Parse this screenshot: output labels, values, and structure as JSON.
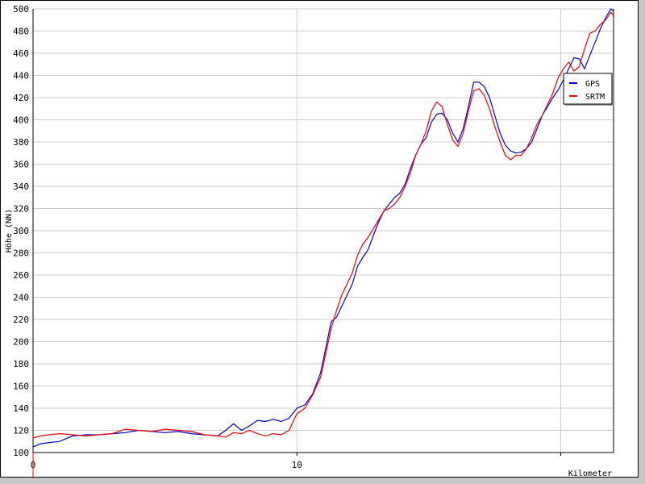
{
  "chart_data": {
    "type": "line",
    "title": "",
    "xlabel": "Kilometer",
    "ylabel": "Höhe (NN)",
    "xlim": [
      0,
      22
    ],
    "ylim": [
      100,
      500
    ],
    "xticks": [
      0,
      10,
      20
    ],
    "xtick_labels": [
      "0",
      "10",
      ""
    ],
    "yticks": [
      100,
      120,
      140,
      160,
      180,
      200,
      220,
      240,
      260,
      280,
      300,
      320,
      340,
      360,
      380,
      400,
      420,
      440,
      460,
      480,
      500
    ],
    "grid": true,
    "legend_position": "right",
    "series": [
      {
        "name": "GPS",
        "color": "#0000dd",
        "points": [
          [
            0.0,
            105
          ],
          [
            0.3,
            108
          ],
          [
            0.6,
            109
          ],
          [
            1.0,
            110
          ],
          [
            1.5,
            115
          ],
          [
            2.0,
            116
          ],
          [
            2.5,
            116
          ],
          [
            3.0,
            117
          ],
          [
            3.5,
            118
          ],
          [
            4.0,
            120
          ],
          [
            4.5,
            119
          ],
          [
            5.0,
            118
          ],
          [
            5.5,
            119
          ],
          [
            6.0,
            117
          ],
          [
            6.5,
            116
          ],
          [
            7.0,
            115
          ],
          [
            7.3,
            120
          ],
          [
            7.6,
            126
          ],
          [
            7.9,
            120
          ],
          [
            8.2,
            124
          ],
          [
            8.5,
            129
          ],
          [
            8.8,
            128
          ],
          [
            9.1,
            130
          ],
          [
            9.4,
            128
          ],
          [
            9.7,
            131
          ],
          [
            10.0,
            140
          ],
          [
            10.3,
            143
          ],
          [
            10.6,
            153
          ],
          [
            10.9,
            172
          ],
          [
            11.1,
            195
          ],
          [
            11.3,
            218
          ],
          [
            11.5,
            222
          ],
          [
            11.7,
            232
          ],
          [
            11.9,
            242
          ],
          [
            12.1,
            252
          ],
          [
            12.3,
            268
          ],
          [
            12.5,
            276
          ],
          [
            12.7,
            283
          ],
          [
            12.9,
            296
          ],
          [
            13.1,
            308
          ],
          [
            13.3,
            318
          ],
          [
            13.5,
            324
          ],
          [
            13.7,
            330
          ],
          [
            13.9,
            334
          ],
          [
            14.1,
            342
          ],
          [
            14.3,
            356
          ],
          [
            14.5,
            368
          ],
          [
            14.7,
            378
          ],
          [
            14.9,
            384
          ],
          [
            15.1,
            398
          ],
          [
            15.3,
            405
          ],
          [
            15.5,
            406
          ],
          [
            15.7,
            400
          ],
          [
            15.9,
            388
          ],
          [
            16.1,
            380
          ],
          [
            16.3,
            392
          ],
          [
            16.5,
            412
          ],
          [
            16.7,
            434
          ],
          [
            16.9,
            434
          ],
          [
            17.1,
            430
          ],
          [
            17.3,
            420
          ],
          [
            17.5,
            404
          ],
          [
            17.7,
            388
          ],
          [
            17.9,
            377
          ],
          [
            18.1,
            372
          ],
          [
            18.3,
            370
          ],
          [
            18.5,
            371
          ],
          [
            18.7,
            374
          ],
          [
            18.9,
            380
          ],
          [
            19.1,
            392
          ],
          [
            19.3,
            404
          ],
          [
            19.5,
            412
          ],
          [
            19.7,
            420
          ],
          [
            19.9,
            427
          ],
          [
            20.1,
            436
          ],
          [
            20.3,
            446
          ],
          [
            20.5,
            456
          ],
          [
            20.7,
            455
          ],
          [
            20.9,
            446
          ],
          [
            21.1,
            458
          ],
          [
            21.3,
            470
          ],
          [
            21.5,
            482
          ],
          [
            21.7,
            492
          ],
          [
            21.9,
            500
          ],
          [
            22.0,
            498
          ]
        ]
      },
      {
        "name": "SRTM",
        "color": "#ee0000",
        "points": [
          [
            0.0,
            113
          ],
          [
            0.3,
            115
          ],
          [
            0.6,
            116
          ],
          [
            1.0,
            117
          ],
          [
            1.5,
            116
          ],
          [
            2.0,
            115
          ],
          [
            2.5,
            116
          ],
          [
            3.0,
            117
          ],
          [
            3.5,
            121
          ],
          [
            4.0,
            120
          ],
          [
            4.5,
            119
          ],
          [
            5.0,
            121
          ],
          [
            5.5,
            120
          ],
          [
            6.0,
            119
          ],
          [
            6.5,
            116
          ],
          [
            7.0,
            115
          ],
          [
            7.3,
            114
          ],
          [
            7.6,
            118
          ],
          [
            7.9,
            117
          ],
          [
            8.2,
            120
          ],
          [
            8.5,
            117
          ],
          [
            8.8,
            115
          ],
          [
            9.1,
            117
          ],
          [
            9.4,
            116
          ],
          [
            9.7,
            120
          ],
          [
            10.0,
            135
          ],
          [
            10.3,
            140
          ],
          [
            10.6,
            152
          ],
          [
            10.9,
            168
          ],
          [
            11.1,
            190
          ],
          [
            11.3,
            212
          ],
          [
            11.5,
            228
          ],
          [
            11.7,
            242
          ],
          [
            11.9,
            252
          ],
          [
            12.1,
            262
          ],
          [
            12.3,
            278
          ],
          [
            12.5,
            288
          ],
          [
            12.7,
            294
          ],
          [
            12.9,
            302
          ],
          [
            13.1,
            310
          ],
          [
            13.3,
            318
          ],
          [
            13.5,
            320
          ],
          [
            13.7,
            324
          ],
          [
            13.9,
            330
          ],
          [
            14.1,
            340
          ],
          [
            14.3,
            352
          ],
          [
            14.5,
            368
          ],
          [
            14.7,
            378
          ],
          [
            14.9,
            390
          ],
          [
            15.1,
            408
          ],
          [
            15.3,
            416
          ],
          [
            15.5,
            412
          ],
          [
            15.7,
            396
          ],
          [
            15.9,
            382
          ],
          [
            16.1,
            376
          ],
          [
            16.3,
            388
          ],
          [
            16.5,
            408
          ],
          [
            16.7,
            426
          ],
          [
            16.9,
            428
          ],
          [
            17.1,
            422
          ],
          [
            17.3,
            410
          ],
          [
            17.5,
            394
          ],
          [
            17.7,
            380
          ],
          [
            17.9,
            368
          ],
          [
            18.1,
            364
          ],
          [
            18.3,
            368
          ],
          [
            18.5,
            368
          ],
          [
            18.7,
            374
          ],
          [
            18.9,
            384
          ],
          [
            19.1,
            396
          ],
          [
            19.3,
            404
          ],
          [
            19.5,
            414
          ],
          [
            19.7,
            424
          ],
          [
            19.9,
            438
          ],
          [
            20.1,
            446
          ],
          [
            20.3,
            452
          ],
          [
            20.5,
            444
          ],
          [
            20.7,
            448
          ],
          [
            20.9,
            464
          ],
          [
            21.1,
            478
          ],
          [
            21.3,
            480
          ],
          [
            21.5,
            486
          ],
          [
            21.7,
            490
          ],
          [
            21.9,
            497
          ],
          [
            22.0,
            494
          ]
        ]
      }
    ]
  }
}
